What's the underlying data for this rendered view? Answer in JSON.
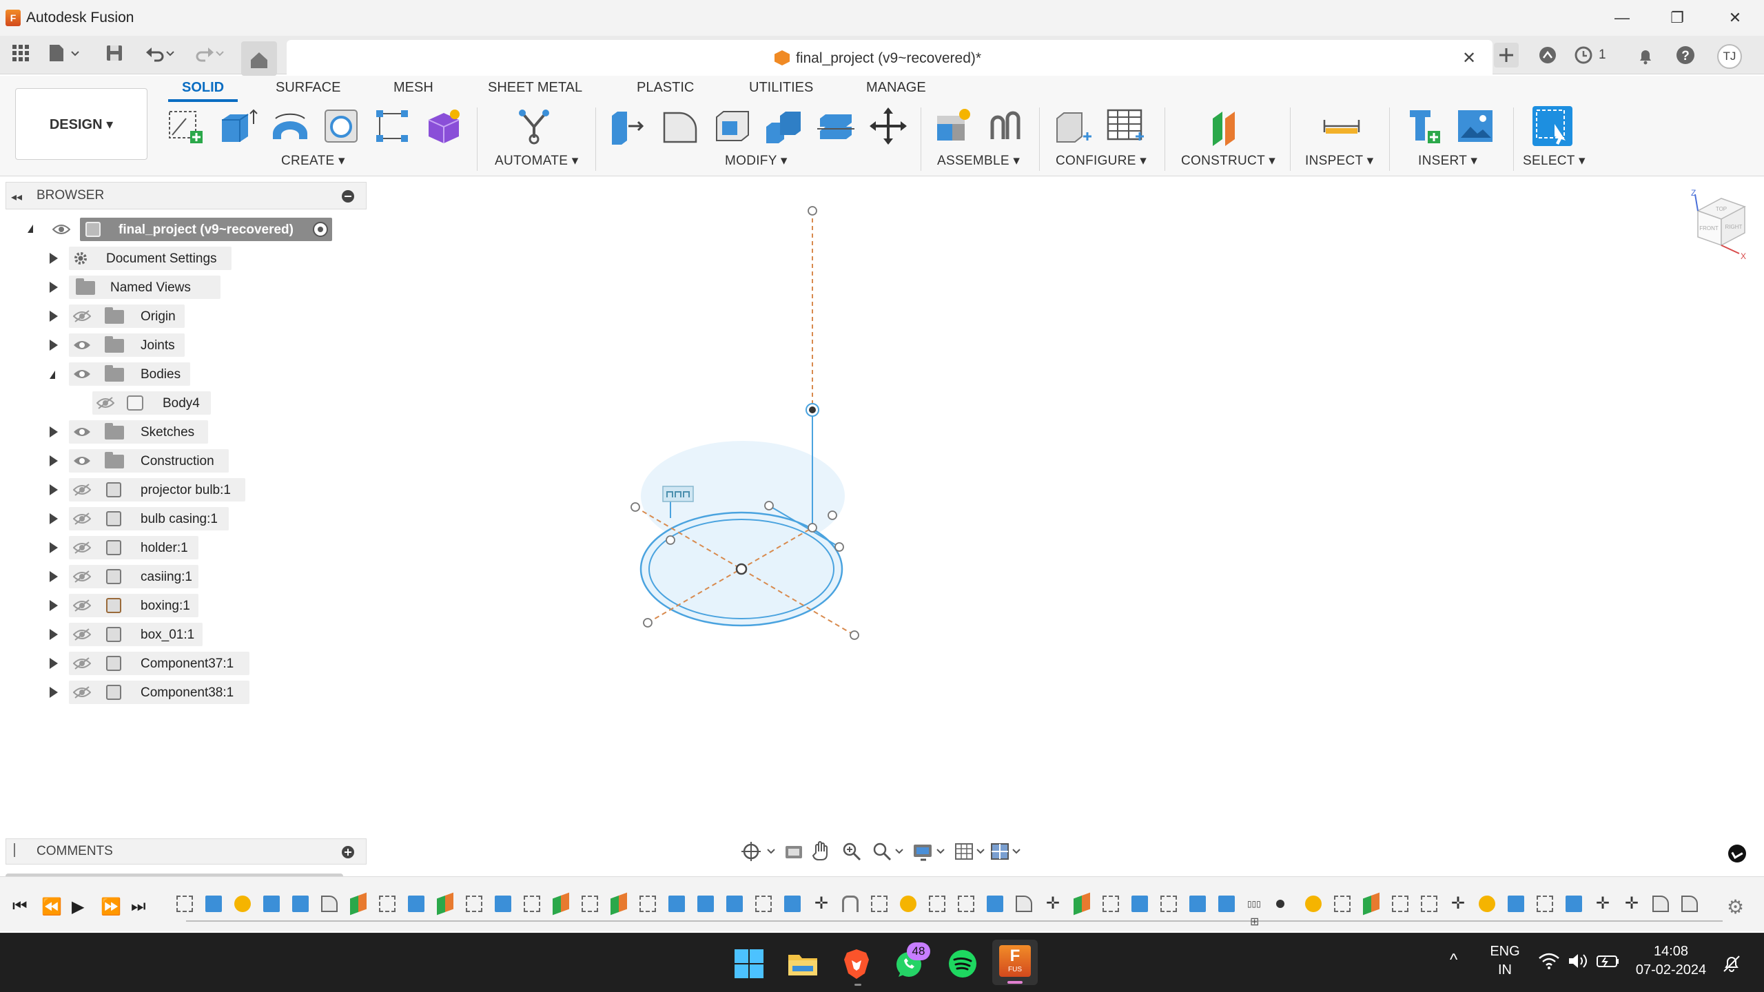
{
  "window": {
    "app_title": "Autodesk Fusion",
    "minimize_label": "—",
    "restore_label": "❐",
    "close_label": "✕"
  },
  "document_tab": {
    "title": "final_project (v9~recovered)*",
    "close_label": "✕",
    "jobs_count": "1",
    "user_initials": "TJ"
  },
  "toolbar": {
    "design_label": "DESIGN ▾",
    "workspace_tabs": [
      "SOLID",
      "SURFACE",
      "MESH",
      "SHEET METAL",
      "PLASTIC",
      "UTILITIES",
      "MANAGE"
    ],
    "groups": {
      "create": "CREATE ▾",
      "automate": "AUTOMATE ▾",
      "modify": "MODIFY ▾",
      "assemble": "ASSEMBLE ▾",
      "configure": "CONFIGURE ▾",
      "construct": "CONSTRUCT ▾",
      "inspect": "INSPECT ▾",
      "insert": "INSERT ▾",
      "select": "SELECT ▾"
    }
  },
  "browser": {
    "title": "BROWSER",
    "root": "final_project (v9~recovered)",
    "items": [
      {
        "label": "Document Settings"
      },
      {
        "label": "Named Views"
      },
      {
        "label": "Origin"
      },
      {
        "label": "Joints"
      },
      {
        "label": "Bodies"
      },
      {
        "label": "Body4"
      },
      {
        "label": "Sketches"
      },
      {
        "label": "Construction"
      },
      {
        "label": "projector bulb:1"
      },
      {
        "label": "bulb casing:1"
      },
      {
        "label": "holder:1"
      },
      {
        "label": "casiing:1"
      },
      {
        "label": "boxing:1"
      },
      {
        "label": "box_01:1"
      },
      {
        "label": "Component37:1"
      },
      {
        "label": "Component38:1"
      }
    ]
  },
  "comments": {
    "title": "COMMENTS"
  },
  "viewcube": {
    "top_label": "TOP",
    "front_label": "FRONT",
    "right_label": "RIGHT",
    "z_axis": "Z",
    "x_axis": "X"
  },
  "taskbar": {
    "whatsapp_badge": "48",
    "fusion_label": "FUS",
    "language_top": "ENG",
    "language_bottom": "IN",
    "time": "14:08",
    "date": "07-02-2024"
  },
  "colors": {
    "accent_blue": "#0a6dc2",
    "fusion_orange": "#f08a24",
    "sketch_blue": "#4aa3df",
    "construction_orange": "#d88a4e"
  }
}
